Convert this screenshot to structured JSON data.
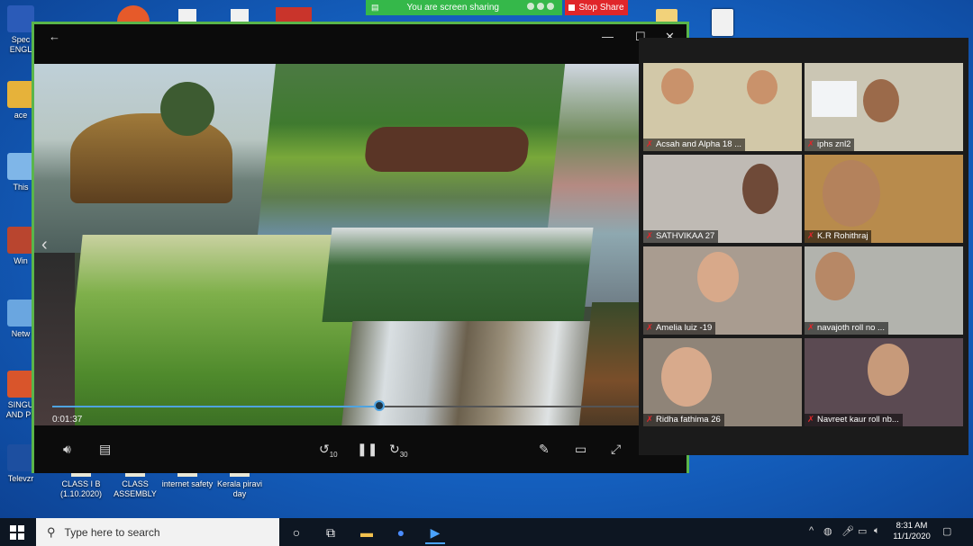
{
  "desktop": {
    "left_icons": [
      {
        "label": "Spec ENGL",
        "color": "#2b5bb8"
      },
      {
        "label": "ace",
        "color": "#e6b23a"
      },
      {
        "label": "This",
        "color": "#7fb6e8"
      },
      {
        "label": "Win",
        "color": "#b9452f"
      },
      {
        "label": "Netw",
        "color": "#6aa6e0"
      },
      {
        "label": "SINGU AND PL",
        "color": "#d9552b"
      },
      {
        "label": "Televzr",
        "color": "#1d4fa0"
      }
    ],
    "bottom_icons": [
      {
        "label": "CLASS I B (1.10.2020)"
      },
      {
        "label": "CLASS ASSEMBLY"
      },
      {
        "label": "internet safety"
      },
      {
        "label": "Kerala piravi day"
      }
    ]
  },
  "share_banner": {
    "text": "You are screen sharing",
    "stop_label": "Stop Share",
    "color": "#35b84a",
    "stop_color": "#e0262a"
  },
  "player": {
    "back_icon": "arrow-left-icon",
    "time": "0:01:37",
    "progress": 0.53,
    "accent": "#4fa3e0"
  },
  "participants": [
    {
      "name": "Acsah and Alpha 18 ...",
      "muted": true,
      "bg": "#d2c8a8"
    },
    {
      "name": "iphs znl2",
      "muted": true,
      "bg": "#cbc6b4",
      "speaking": true
    },
    {
      "name": "SATHVIKAA 27",
      "muted": true,
      "bg": "#bfbab4"
    },
    {
      "name": "K.R Rohithraj",
      "muted": true,
      "bg": "#b88b4c"
    },
    {
      "name": "Amelia luiz -19",
      "muted": true,
      "bg": "#a99c90"
    },
    {
      "name": "navajoth    roll      no ...",
      "muted": true,
      "bg": "#b2b3ad"
    },
    {
      "name": "Ridha      fathima      26",
      "muted": true,
      "bg": "#8f8478"
    },
    {
      "name": "Navreet kaur roll nb...",
      "muted": true,
      "bg": "#5b4a52"
    }
  ],
  "taskbar": {
    "search_placeholder": "Type here to search",
    "time": "8:31 AM",
    "date": "11/1/2020"
  }
}
